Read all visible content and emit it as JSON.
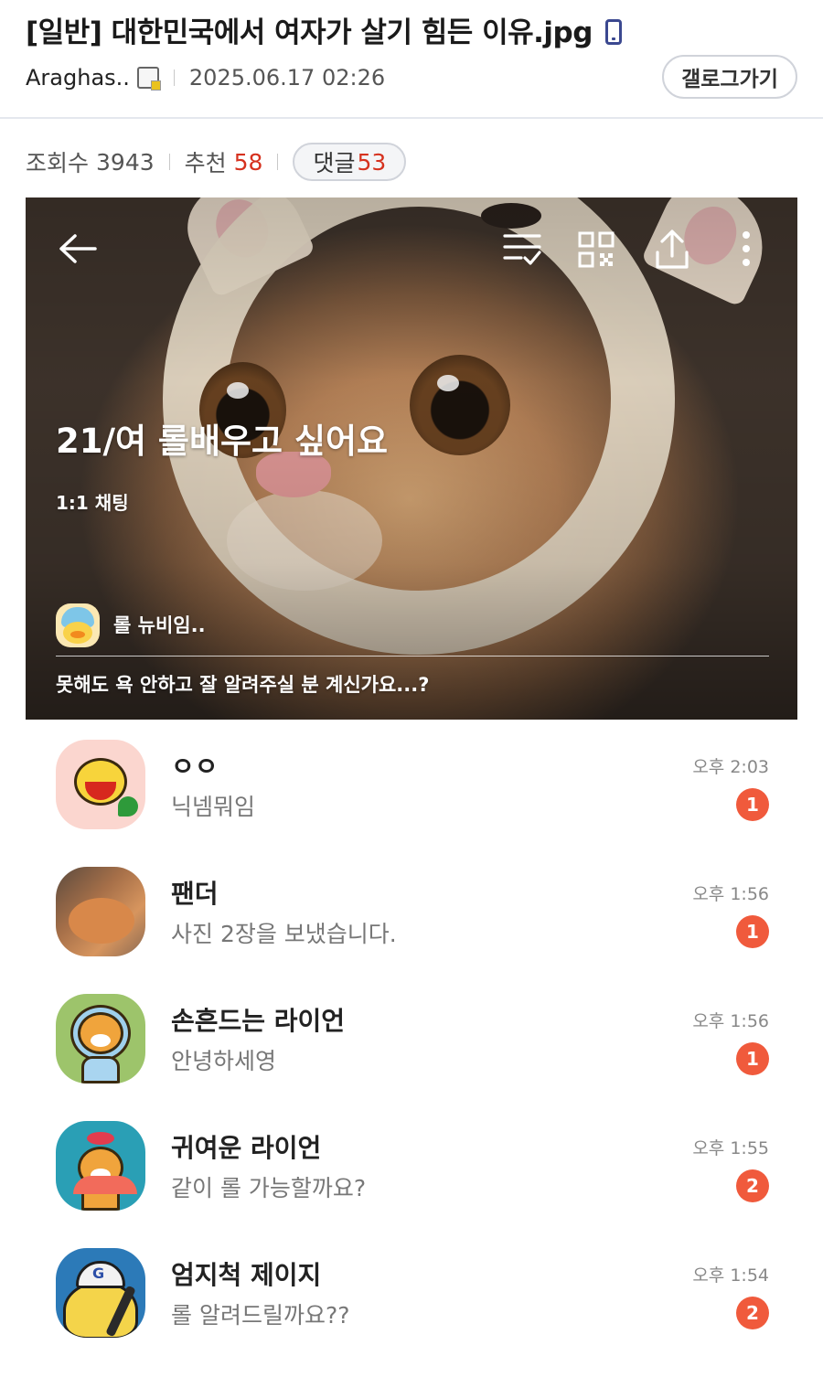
{
  "post": {
    "title": "[일반] 대한민국에서 여자가 살기 힘든 이유.jpg",
    "author": "Araghas..",
    "date": "2025.06.17 02:26",
    "gallery_button": "갤로그가기",
    "views_label": "조회수",
    "views": "3943",
    "recommend_label": "추천",
    "recommend": "58",
    "comments_label": "댓글",
    "comments": "53"
  },
  "chatroom": {
    "title": "21/여 롤배우고 싶어요",
    "type": "1:1 채팅",
    "host_name": "롤 뉴비임..",
    "description": "못해도 욕 안하고 잘 알려주실 분 계신가요...?"
  },
  "chats": [
    {
      "name": "ㅇㅇ",
      "preview": "닉넴뭐임",
      "time": "오후 2:03",
      "unread": "1"
    },
    {
      "name": "팬더",
      "preview": "사진 2장을 보냈습니다.",
      "time": "오후 1:56",
      "unread": "1"
    },
    {
      "name": "손흔드는 라이언",
      "preview": "안녕하세영",
      "time": "오후 1:56",
      "unread": "1"
    },
    {
      "name": "귀여운 라이언",
      "preview": "같이 롤 가능할까요?",
      "time": "오후 1:55",
      "unread": "2"
    },
    {
      "name": "엄지척 제이지",
      "preview": "롤 알려드릴까요??",
      "time": "오후 1:54",
      "unread": "2"
    }
  ],
  "icons": {
    "device": "mobile-icon",
    "author_badge": "gallog-icon",
    "back": "back-arrow-icon",
    "sort": "sort-check-icon",
    "qr": "qr-code-icon",
    "share": "share-icon",
    "more": "more-vertical-icon"
  },
  "colors": {
    "accent_red": "#d6321f",
    "unread_badge": "#f05a3c",
    "device_icon": "#3b4890"
  }
}
